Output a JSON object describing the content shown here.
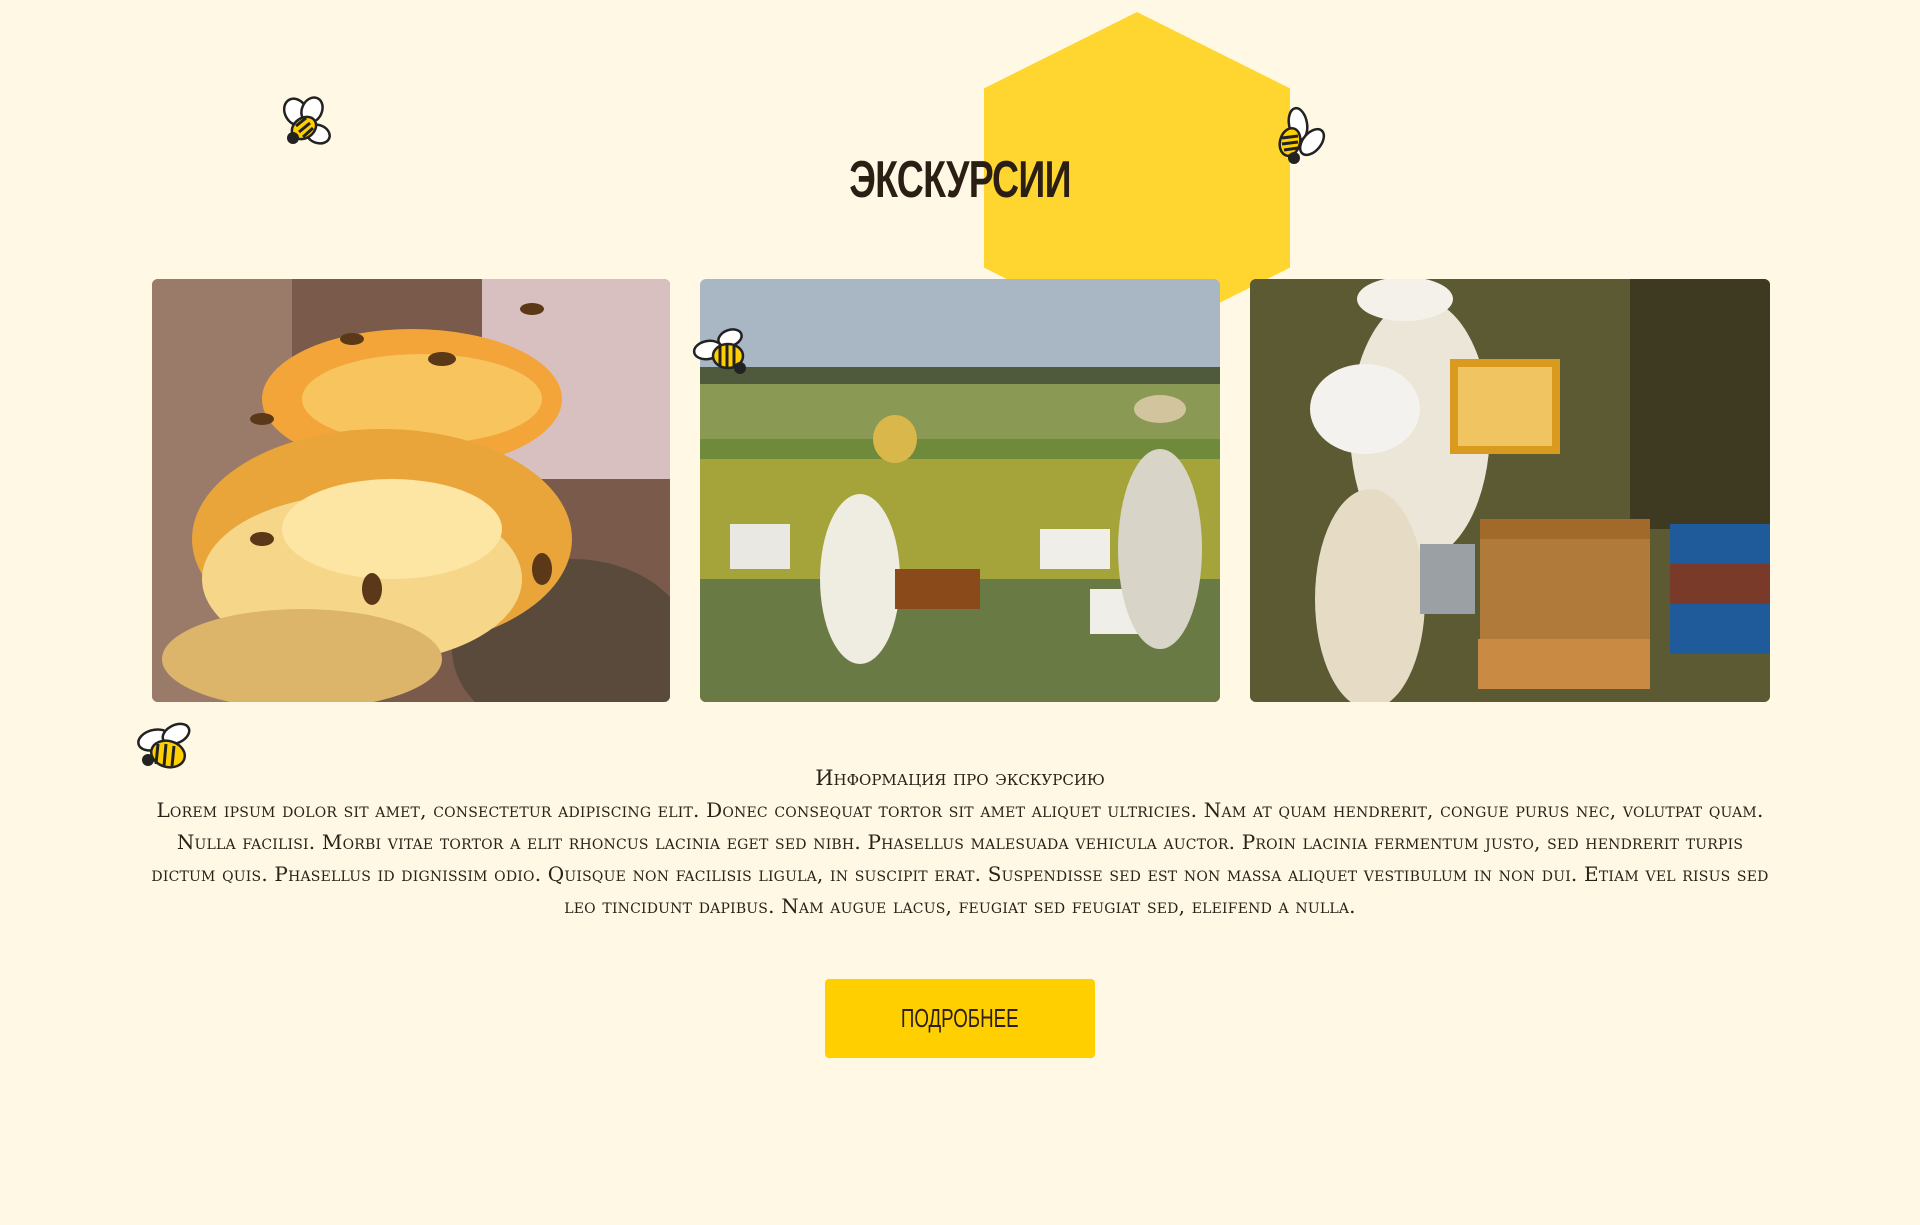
{
  "section": {
    "title": "ЭКСКУРСИИ"
  },
  "gallery": [
    {
      "name": "honeycomb-photo",
      "icon": "honeycomb-with-bees"
    },
    {
      "name": "field-beekeepers-photo",
      "icon": "beekeepers-in-field"
    },
    {
      "name": "beehive-photo",
      "icon": "beekeepers-at-hive"
    }
  ],
  "info": {
    "heading": "Информация про экскурсию",
    "body": "Lorem ipsum dolor sit amet, consectetur adipiscing elit. Donec consequat tortor sit amet aliquet ultricies. Nam at quam hendrerit, congue purus nec, volutpat quam. Nulla facilisi. Morbi vitae tortor a elit rhoncus lacinia eget sed nibh. Phasellus malesuada vehicula auctor. Proin lacinia fermentum justo, sed hendrerit turpis dictum quis. Phasellus id dignissim odio. Quisque non facilisis ligula, in suscipit erat. Suspendisse sed est non massa aliquet vestibulum in non dui. Etiam vel risus sed leo tincidunt dapibus. Nam augue lacus, feugiat sed feugiat sed, eleifend a nulla."
  },
  "cta": {
    "label": "ПОДРОБНЕЕ"
  },
  "colors": {
    "background": "#fff8e5",
    "hexagon": "#ffd630",
    "button": "#ffcf00",
    "text": "#2a2218"
  },
  "decorations": [
    "bee-icon",
    "bee-icon",
    "bee-icon",
    "bee-icon"
  ]
}
